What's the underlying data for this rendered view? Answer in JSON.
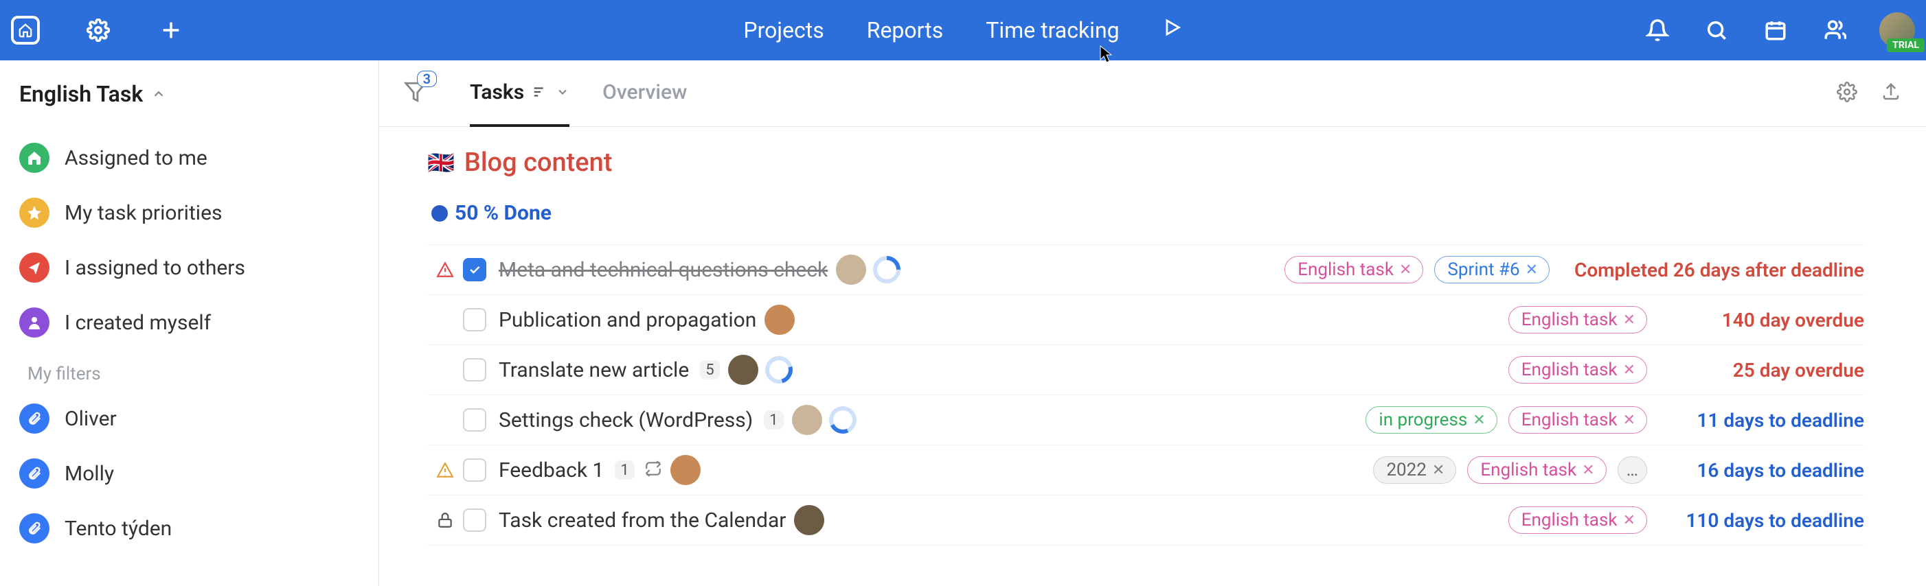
{
  "topnav": {
    "items": [
      "Projects",
      "Reports",
      "Time tracking"
    ],
    "trial_badge": "TRIAL"
  },
  "sidebar": {
    "title": "English Task",
    "builtin": [
      {
        "label": "Assigned to me",
        "color": "#35b668",
        "icon": "home"
      },
      {
        "label": "My task priorities",
        "color": "#f0b43a",
        "icon": "star"
      },
      {
        "label": "I assigned to others",
        "color": "#e54a3e",
        "icon": "share"
      },
      {
        "label": "I created myself",
        "color": "#8c4fd9",
        "icon": "user"
      }
    ],
    "filters_heading": "My filters",
    "filters": [
      {
        "label": "Oliver"
      },
      {
        "label": "Molly"
      },
      {
        "label": "Tento týden"
      }
    ]
  },
  "content_header": {
    "filter_count": "3",
    "tab_tasks": "Tasks",
    "tab_overview": "Overview"
  },
  "group": {
    "flag": "🇬🇧",
    "title": "Blog content",
    "subtitle": "50 % Done"
  },
  "tasks": [
    {
      "gutter": "warn-red",
      "checked": true,
      "title": "Meta and technical questions check",
      "done": true,
      "subcount": null,
      "repeat": false,
      "lock": false,
      "avatar": "a1",
      "ring": "r1",
      "chips": [
        {
          "text": "English task",
          "cls": "pink",
          "x": true
        },
        {
          "text": "Sprint #6",
          "cls": "blue",
          "x": true
        }
      ],
      "date": {
        "text": "Completed 26 days after deadline",
        "cls": "red"
      }
    },
    {
      "gutter": null,
      "checked": false,
      "title": "Publication and propagation",
      "done": false,
      "subcount": null,
      "repeat": false,
      "lock": false,
      "avatar": "a2",
      "ring": null,
      "chips": [
        {
          "text": "English task",
          "cls": "pink",
          "x": true
        }
      ],
      "date": {
        "text": "140 day overdue",
        "cls": "red"
      }
    },
    {
      "gutter": null,
      "checked": false,
      "title": "Translate new article",
      "done": false,
      "subcount": "5",
      "repeat": false,
      "lock": false,
      "avatar": "a3",
      "ring": "r2",
      "chips": [
        {
          "text": "English task",
          "cls": "pink",
          "x": true
        }
      ],
      "date": {
        "text": "25 day overdue",
        "cls": "red"
      }
    },
    {
      "gutter": null,
      "checked": false,
      "title": "Settings check (WordPress)",
      "done": false,
      "subcount": "1",
      "repeat": false,
      "lock": false,
      "avatar": "a1",
      "ring": "r3",
      "chips": [
        {
          "text": "in progress",
          "cls": "green",
          "x": true
        },
        {
          "text": "English task",
          "cls": "pink",
          "x": true
        }
      ],
      "date": {
        "text": "11 days to deadline",
        "cls": "blue"
      }
    },
    {
      "gutter": "warn-amb",
      "checked": false,
      "title": "Feedback 1",
      "done": false,
      "subcount": "1",
      "repeat": true,
      "lock": false,
      "avatar": "a2",
      "ring": null,
      "chips": [
        {
          "text": "2022",
          "cls": "gray",
          "x": true
        },
        {
          "text": "English task",
          "cls": "pink",
          "x": true
        },
        {
          "text": "…",
          "cls": "gray dots",
          "x": false
        }
      ],
      "date": {
        "text": "16 days to deadline",
        "cls": "blue"
      }
    },
    {
      "gutter": null,
      "checked": false,
      "title": "Task created from the Calendar",
      "done": false,
      "subcount": null,
      "repeat": false,
      "lock": true,
      "avatar": "a3",
      "ring": null,
      "chips": [
        {
          "text": "English task",
          "cls": "pink",
          "x": true
        }
      ],
      "date": {
        "text": "110 days to deadline",
        "cls": "blue"
      }
    }
  ]
}
